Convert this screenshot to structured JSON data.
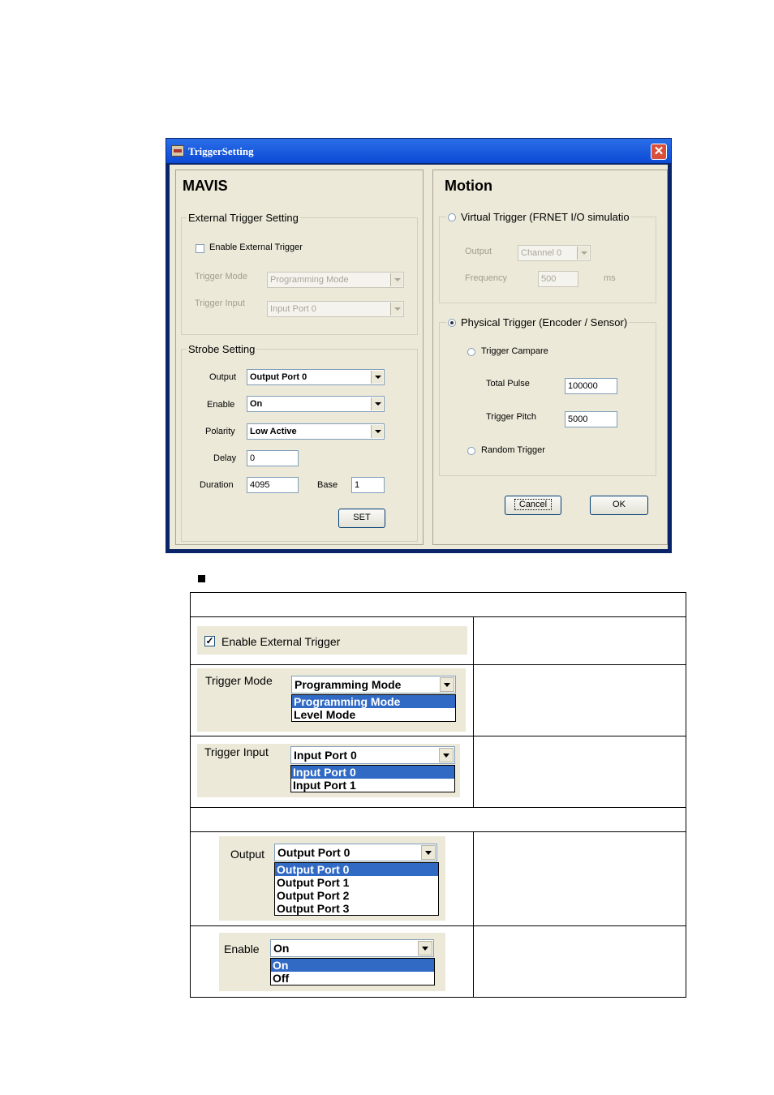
{
  "window": {
    "title": "TriggerSetting"
  },
  "mavis": {
    "title": "MAVIS",
    "external": {
      "group_label": "External Trigger Setting",
      "enable_label": "Enable External Trigger",
      "enable_checked": false,
      "mode_label": "Trigger Mode",
      "mode_value": "Programming Mode",
      "input_label": "Trigger Input",
      "input_value": "Input Port 0"
    },
    "strobe": {
      "group_label": "Strobe Setting",
      "output_label": "Output",
      "output_value": "Output Port 0",
      "enable_label": "Enable",
      "enable_value": "On",
      "polarity_label": "Polarity",
      "polarity_value": "Low Active",
      "delay_label": "Delay",
      "delay_value": "0",
      "duration_label": "Duration",
      "duration_value": "4095",
      "base_label": "Base",
      "base_value": "1",
      "set_button": "SET"
    }
  },
  "motion": {
    "title": "Motion",
    "virtual": {
      "radio_label": "Virtual Trigger (FRNET I/O simulatio",
      "selected": false,
      "output_label": "Output",
      "output_value": "Channel 0",
      "frequency_label": "Frequency",
      "frequency_value": "500",
      "frequency_unit": "ms"
    },
    "physical": {
      "radio_label": "Physical Trigger (Encoder / Sensor)",
      "selected": true,
      "compare_label": "Trigger Campare",
      "total_pulse_label": "Total Pulse",
      "total_pulse_value": "100000",
      "pitch_label": "Trigger Pitch",
      "pitch_value": "5000",
      "random_label": "Random Trigger"
    },
    "cancel_button": "Cancel",
    "ok_button": "OK"
  },
  "table": {
    "enable_trigger": {
      "label": "Enable External Trigger",
      "checked": true
    },
    "trigger_mode": {
      "label": "Trigger Mode",
      "value": "Programming Mode",
      "options": [
        "Programming Mode",
        "Level Mode"
      ]
    },
    "trigger_input": {
      "label": "Trigger Input",
      "value": "Input Port 0",
      "options": [
        "Input Port 0",
        "Input Port 1"
      ]
    },
    "output": {
      "label": "Output",
      "value": "Output Port 0",
      "options": [
        "Output Port 0",
        "Output Port 1",
        "Output Port 2",
        "Output Port 3"
      ]
    },
    "enable": {
      "label": "Enable",
      "value": "On",
      "options": [
        "On",
        "Off"
      ]
    }
  },
  "colors": {
    "titlebar": "#0b4ad4",
    "dialog_bg": "#ece9d8",
    "selection": "#316ac5"
  }
}
